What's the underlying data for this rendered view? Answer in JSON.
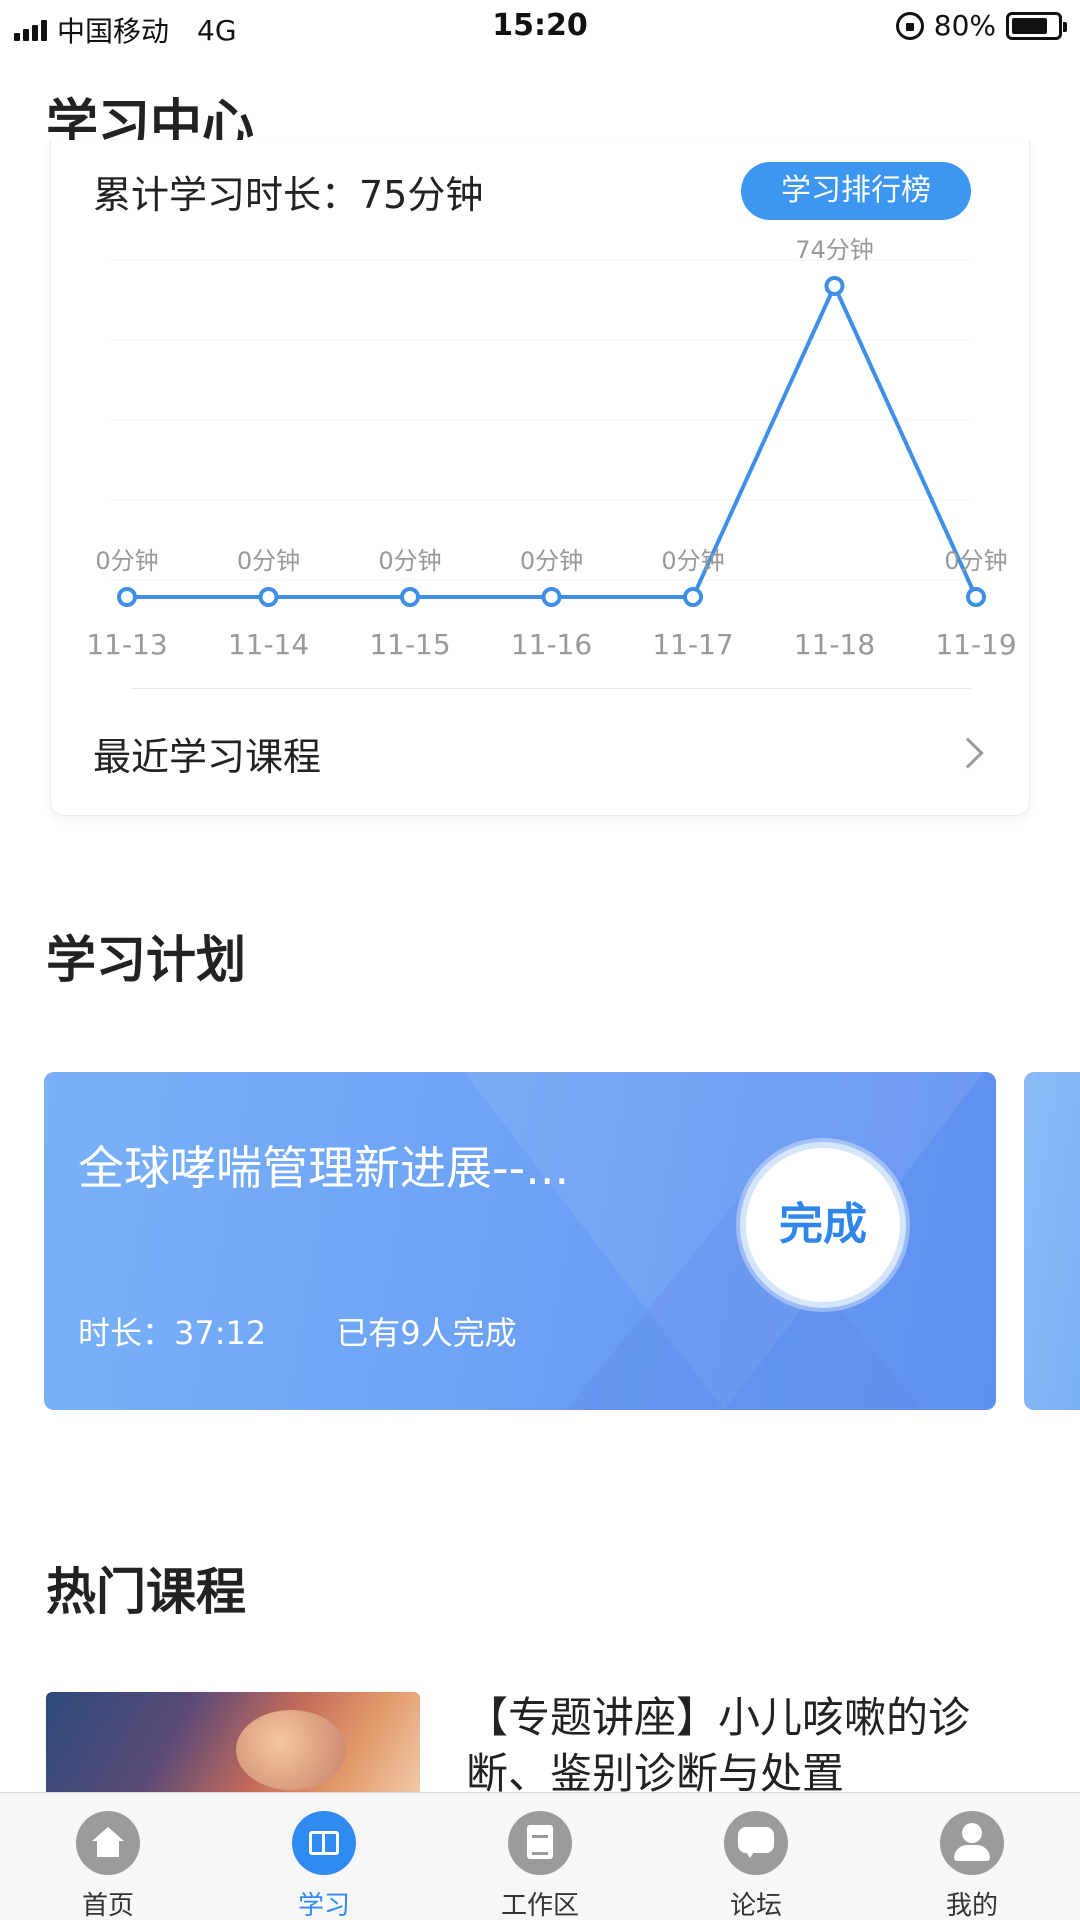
{
  "status_bar": {
    "carrier": "中国移动",
    "network": "4G",
    "time": "15:20",
    "battery": "80%",
    "battery_level": 0.8
  },
  "page": {
    "title": "学习中心"
  },
  "stats": {
    "total_time": "累计学习时长：75分钟",
    "rank_button": "学习排行榜",
    "recent_courses": "最近学习课程"
  },
  "chart_data": {
    "type": "line",
    "categories": [
      "11-13",
      "11-14",
      "11-15",
      "11-16",
      "11-17",
      "11-18",
      "11-19"
    ],
    "values": [
      0,
      0,
      0,
      0,
      0,
      74,
      0
    ],
    "data_labels": [
      "0分钟",
      "0分钟",
      "0分钟",
      "0分钟",
      "0分钟",
      "74分钟",
      "0分钟"
    ],
    "color": "#3f8fe6",
    "grid": true,
    "ylim": [
      0,
      74
    ]
  },
  "plan": {
    "section_title": "学习计划",
    "card": {
      "title": "全球哮喘管理新进展--...",
      "duration": "时长：37:12",
      "completed": "已有9人完成",
      "button": "完成"
    }
  },
  "hot": {
    "section_title": "热门课程",
    "course": {
      "title": "【专题讲座】小儿咳嗽的诊断、鉴别诊断与处置"
    }
  },
  "tabs": [
    {
      "label": "首页",
      "icon": "home-icon",
      "active": false
    },
    {
      "label": "学习",
      "icon": "book-icon",
      "active": true
    },
    {
      "label": "工作区",
      "icon": "clipboard-icon",
      "active": false
    },
    {
      "label": "论坛",
      "icon": "chat-icon",
      "active": false
    },
    {
      "label": "我的",
      "icon": "user-icon",
      "active": false
    }
  ],
  "colors": {
    "accent": "#2f8bf0",
    "plan_card": "#6ea3f5"
  }
}
